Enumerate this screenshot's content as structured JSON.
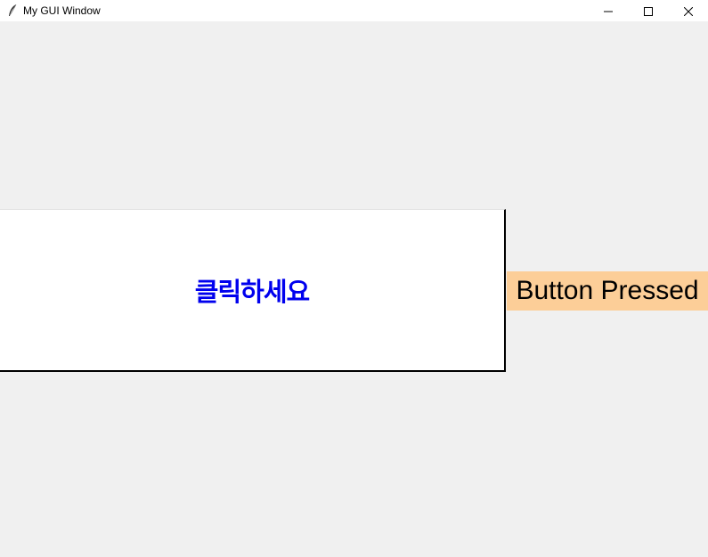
{
  "window": {
    "title": "My GUI Window",
    "icon": "feather-icon",
    "controls": {
      "minimize_icon": "minimize-icon",
      "maximize_icon": "maximize-icon",
      "close_icon": "close-icon"
    }
  },
  "main": {
    "click_button_label": "클릭하세요",
    "click_button_color": "#0000ee",
    "click_button_bg": "#ffffff",
    "status_label": "Button Pressed",
    "status_label_bg": "#fcce98"
  },
  "colors": {
    "window_bg": "#f0f0f0",
    "titlebar_bg": "#ffffff"
  }
}
